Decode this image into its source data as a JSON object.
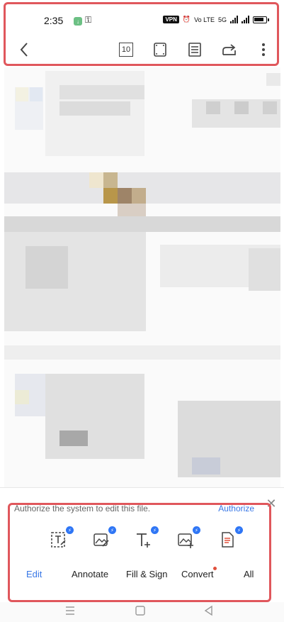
{
  "status_bar": {
    "time": "2:35",
    "vpn": "VPN",
    "volte": "Vo LTE",
    "network": "5G"
  },
  "toolbar": {
    "page_number": "10",
    "icons": [
      "back-arrow-icon",
      "page-number-icon",
      "fullscreen-icon",
      "reading-mode-icon",
      "share-icon",
      "more-vertical-icon"
    ]
  },
  "notice": {
    "text": "Authorize the system to edit this file.",
    "action": "Authorize"
  },
  "tools": {
    "icons": [
      "edit-text-icon",
      "edit-image-icon",
      "add-text-icon",
      "add-image-icon",
      "pdf-convert-icon"
    ],
    "tabs": [
      "Edit",
      "Annotate",
      "Fill & Sign",
      "Convert",
      "All"
    ],
    "active_tab": "Edit"
  },
  "colors": {
    "accent": "#3877e6",
    "highlight_border": "#e0575c",
    "badge": "#2f76f5"
  }
}
